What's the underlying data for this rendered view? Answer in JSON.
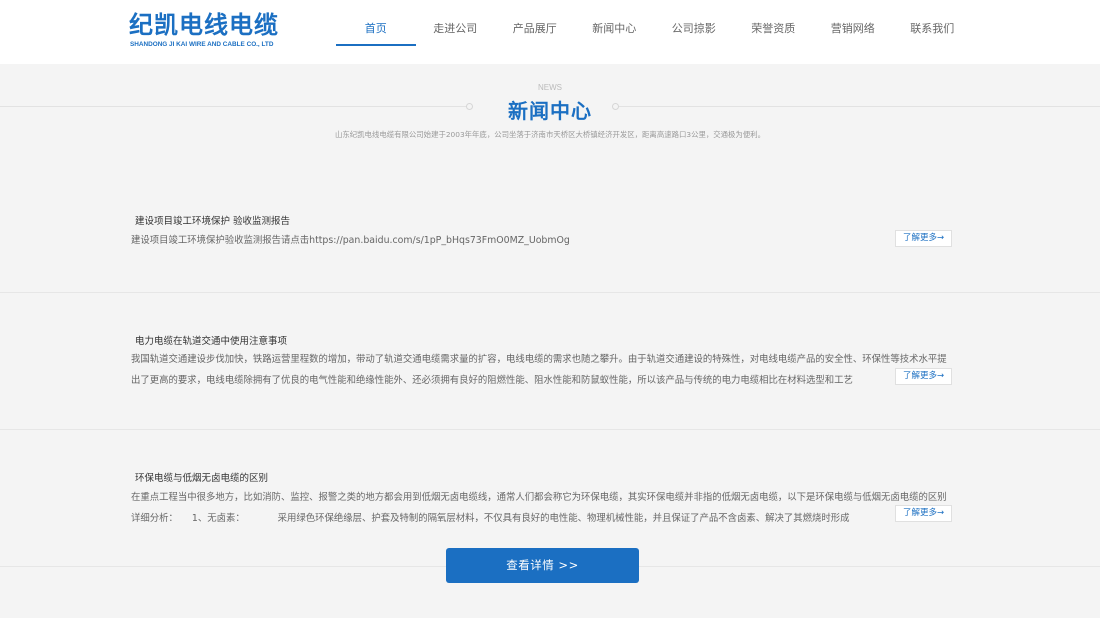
{
  "header": {
    "logo_main": "纪凯电线电缆",
    "logo_sub": "SHANDONG JI KAI WIRE AND CABLE CO., LTD",
    "nav": [
      {
        "label": "首页",
        "active": true
      },
      {
        "label": "走进公司",
        "active": false
      },
      {
        "label": "产品展厅",
        "active": false
      },
      {
        "label": "新闻中心",
        "active": false
      },
      {
        "label": "公司掠影",
        "active": false
      },
      {
        "label": "荣誉资质",
        "active": false
      },
      {
        "label": "营销网络",
        "active": false
      },
      {
        "label": "联系我们",
        "active": false
      }
    ]
  },
  "section": {
    "subtitle_en": "NEWS",
    "title": "新闻中心",
    "description": "山东纪凯电线电缆有限公司始建于2003年年底，公司坐落于济南市天桥区大桥镇经济开发区，距离高速路口3公里，交通极为便利。"
  },
  "news": [
    {
      "title": "建设项目竣工环境保护 验收监测报告",
      "text": "建设项目竣工环境保护验收监测报告请点击https://pan.baidu.com/s/1pP_bHqs73FmO0MZ_UobmOg",
      "more": "了解更多→"
    },
    {
      "title": "电力电缆在轨道交通中使用注意事项",
      "text": "我国轨道交通建设步伐加快，铁路运营里程数的增加，带动了轨道交通电缆需求量的扩容，电线电缆的需求也随之攀升。由于轨道交通建设的特殊性，对电线电缆产品的安全性、环保性等技术水平提出了更高的要求，电线电缆除拥有了优良的电气性能和绝缘性能外、还必须拥有良好的阻燃性能、阻水性能和防鼠蚁性能，所以该产品与传统的电力电缆相比在材料选型和工艺",
      "more": "了解更多→"
    },
    {
      "title": "环保电缆与低烟无卤电缆的区别",
      "text": "在重点工程当中很多地方，比如消防、监控、报警之类的地方都会用到低烟无卤电缆线，通常人们都会称它为环保电缆，其实环保电缆并非指的低烟无卤电缆，以下是环保电缆与低烟无卤电缆的区别详细分析：　　1、无卤素：　　　　采用绿色环保绝缘层、护套及特制的隔氧层材料，不仅具有良好的电性能、物理机械性能，并且保证了产品不含卤素、解决了其燃烧时形成",
      "more": "了解更多→"
    }
  ],
  "detail_button": "查看详情 >>"
}
